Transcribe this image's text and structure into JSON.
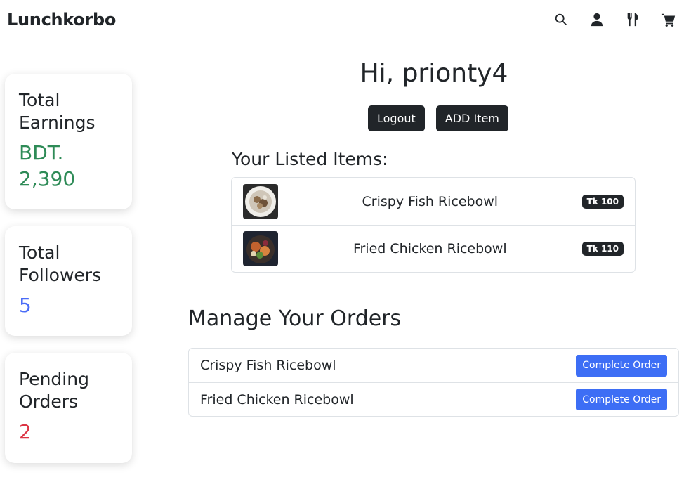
{
  "nav": {
    "brand": "Lunchkorbo",
    "icons": [
      "search-icon",
      "user-icon",
      "utensils-icon",
      "cart-icon"
    ]
  },
  "stats": {
    "earnings": {
      "label": "Total Earnings",
      "value": "BDT. 2,390",
      "color": "#2e8b57"
    },
    "followers": {
      "label": "Total Followers",
      "value": "5",
      "color": "#4a6cf7"
    },
    "pending": {
      "label": "Pending Orders",
      "value": "2",
      "color": "#dc3545"
    }
  },
  "main": {
    "greeting": "Hi, prionty4",
    "logout_label": "Logout",
    "add_item_label": "ADD Item",
    "listed_title": "Your Listed Items:",
    "listed_items": [
      {
        "name": "Crispy Fish Ricebowl",
        "price": "Tk 100"
      },
      {
        "name": "Fried Chicken Ricebowl",
        "price": "Tk 110"
      }
    ],
    "orders_title": "Manage Your Orders",
    "orders": [
      {
        "name": "Crispy Fish Ricebowl",
        "action": "Complete Order"
      },
      {
        "name": "Fried Chicken Ricebowl",
        "action": "Complete Order"
      }
    ]
  },
  "colors": {
    "dark_button": "#212529",
    "primary_button": "#3d6ef5"
  }
}
